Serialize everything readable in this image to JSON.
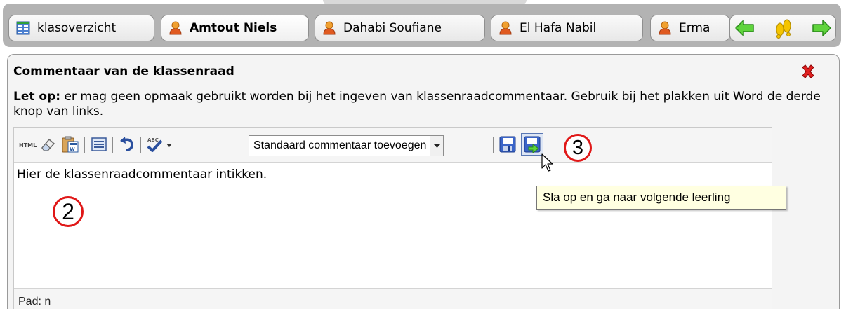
{
  "tabs": {
    "overview": {
      "label": "klasoverzicht"
    },
    "students": [
      {
        "label": "Amtout Niels",
        "active": true
      },
      {
        "label": "Dahabi Soufiane",
        "active": false
      },
      {
        "label": "El Hafa Nabil",
        "active": false
      },
      {
        "label": "Erma",
        "active": false
      }
    ],
    "nav": {
      "prev_icon": "arrow-left-icon",
      "students_icon": "footsteps-icon",
      "next_icon": "arrow-right-icon"
    }
  },
  "panel": {
    "title": "Commentaar van de klassenraad",
    "notice_bold": "Let op:",
    "notice_text": " er mag geen opmaak gebruikt worden bij het ingeven van klassenraadcommentaar. Gebruik bij het plakken uit Word de derde knop van links."
  },
  "editor": {
    "toolbar": {
      "icons": [
        "html-source-icon",
        "eraser-icon",
        "paste-from-word-icon",
        "select-all-icon",
        "undo-icon",
        "spellcheck-icon",
        "save-icon",
        "save-next-icon"
      ],
      "html_label": "HTML",
      "dropdown_value": "Standaard commentaar toevoegen"
    },
    "content": "Hier de klassenraadcommentaar intikken.",
    "path_label": "Pad: n"
  },
  "annotations": {
    "step2": "2",
    "step3": "3",
    "tooltip": "Sla op en ga naar volgende leerling"
  },
  "colors": {
    "accent_red": "#e01818",
    "tooltip_bg": "#ffffe1",
    "nav_green": "#3cbf2c"
  }
}
